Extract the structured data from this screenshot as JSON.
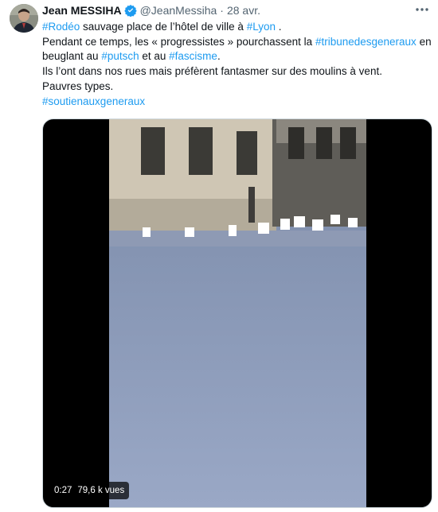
{
  "tweet": {
    "author_name": "Jean MESSIHA",
    "handle": "@JeanMessiha",
    "separator": "·",
    "date": "28 avr.",
    "more_icon": "more-horizontal-icon",
    "verified_icon": "verified-badge-icon",
    "body": {
      "line1": {
        "tag_rodeo": "#Rodéo",
        "text_a": " sauvage place de l’hôtel de ville à ",
        "tag_lyon": "#Lyon",
        "text_b": " ."
      },
      "line2": {
        "text_a": "Pendant ce temps, les « progressistes » pourchassent la ",
        "tag_tribune": "#tribunedesgeneraux",
        "text_b": " en"
      },
      "line3": {
        "text_a": "beuglant au ",
        "tag_putsch": "#putsch",
        "text_b": " et au ",
        "tag_fascisme": "#fascisme",
        "text_c": "."
      },
      "line4": "Ils l’ont dans nos rues mais préfèrent fantasmer sur des moulins à vent.",
      "line5": "Pauvres types.",
      "line6": {
        "tag_soutien": "#soutienauxgeneraux"
      }
    },
    "video": {
      "duration": "0:27",
      "views": "79,6 k vues"
    },
    "colors": {
      "link": "#1d9bf0",
      "text": "#0f1419",
      "muted": "#536471"
    }
  }
}
